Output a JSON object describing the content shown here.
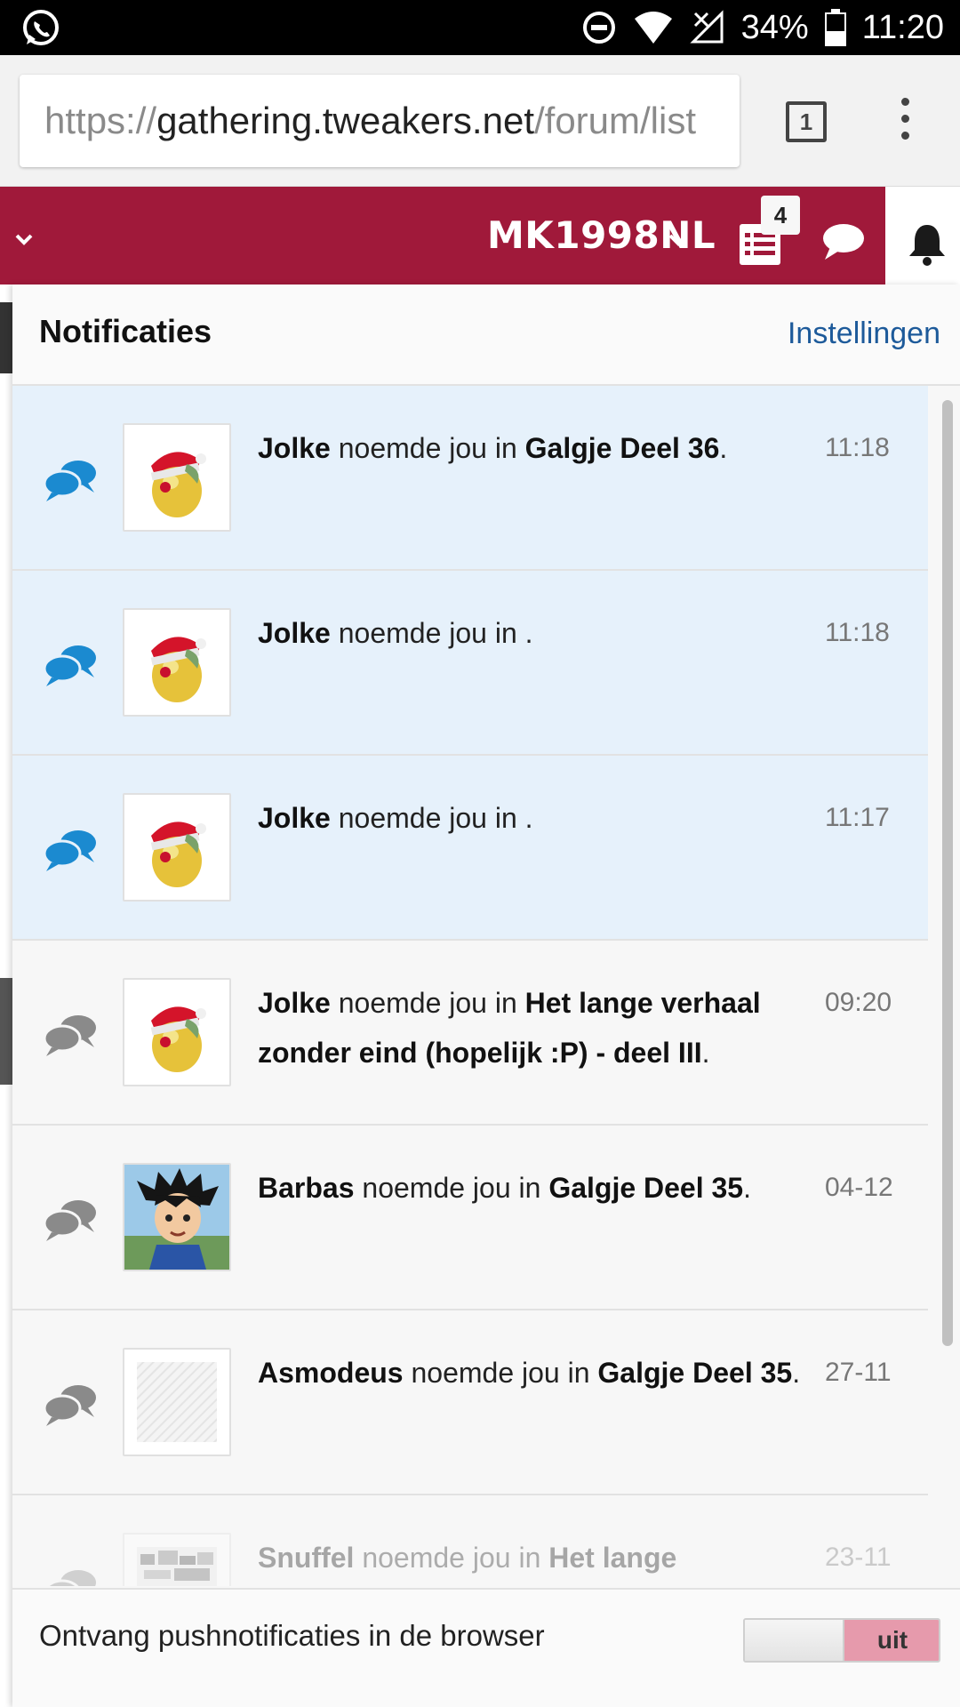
{
  "status_bar": {
    "app_icon": "whatsapp-icon",
    "icons": [
      "do-not-disturb-icon",
      "wifi-icon",
      "no-signal-icon",
      "battery-icon"
    ],
    "battery": "34%",
    "time": "11:20"
  },
  "browser": {
    "url_scheme": "https://",
    "url_host": "gathering.tweakers.net",
    "url_path": "/forum/list",
    "tab_count": "1"
  },
  "site_header": {
    "username": "MK1998NL",
    "news_badge": "4",
    "colors": {
      "brand": "#a0193a"
    }
  },
  "notifications": {
    "title": "Notificaties",
    "settings_link": "Instellingen",
    "items": [
      {
        "user": "Jolke",
        "verb": "noemde jou in",
        "topic": "Galgje Deel 36",
        "end": ".",
        "time": "11:18",
        "unread": true,
        "avatar": "santa-bird"
      },
      {
        "user": "Jolke",
        "verb": "noemde jou in",
        "topic": "",
        "end": ".",
        "time": "11:18",
        "unread": true,
        "avatar": "santa-bird"
      },
      {
        "user": "Jolke",
        "verb": "noemde jou in",
        "topic": "",
        "end": ".",
        "time": "11:17",
        "unread": true,
        "avatar": "santa-bird"
      },
      {
        "user": "Jolke",
        "verb": "noemde jou in",
        "topic": "Het lange verhaal zonder eind (hopelijk :P) - deel III",
        "end": ".",
        "time": "09:20",
        "unread": false,
        "avatar": "santa-bird"
      },
      {
        "user": "Barbas",
        "verb": "noemde jou in",
        "topic": "Galgje Deel 35",
        "end": ".",
        "time": "04-12",
        "unread": false,
        "avatar": "anime-boy"
      },
      {
        "user": "Asmodeus",
        "verb": "noemde jou in",
        "topic": "Galgje Deel 35",
        "end": ".",
        "time": "27-11",
        "unread": false,
        "avatar": "placeholder"
      },
      {
        "user": "Snuffel",
        "verb": "noemde jou in",
        "topic": "Het lange",
        "end": "",
        "time": "23-11",
        "unread": false,
        "avatar": "pixel"
      }
    ],
    "footer_label": "Ontvang pushnotificaties in de browser",
    "toggle_state": "uit"
  }
}
